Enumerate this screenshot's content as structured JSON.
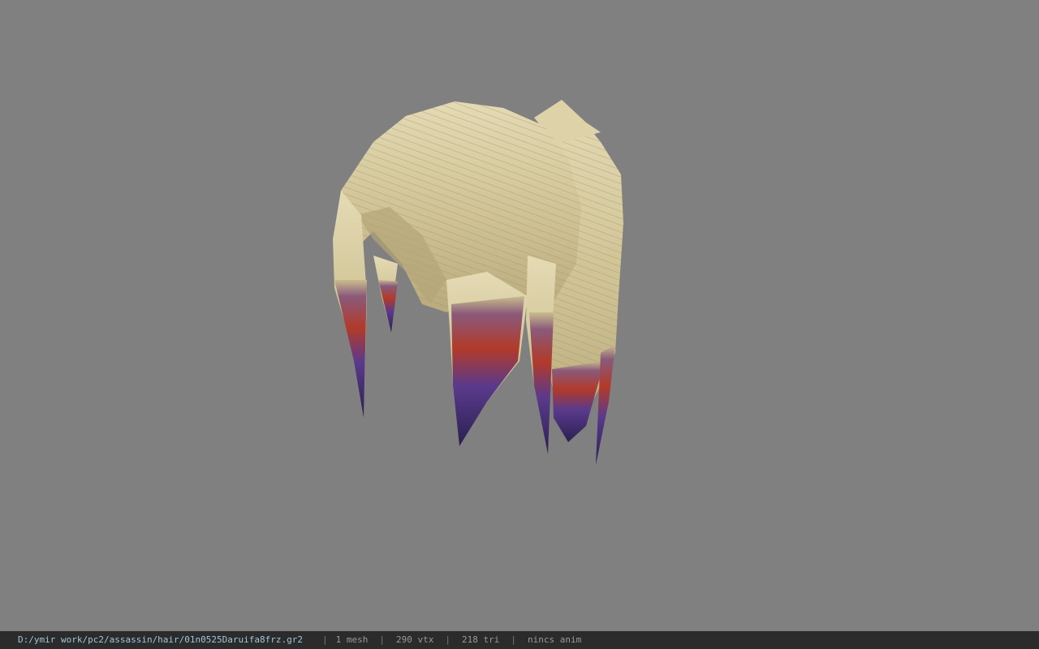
{
  "viewport": {
    "background_color": "#808080",
    "model_icon": "hair-mesh-icon"
  },
  "status": {
    "file_path": "D:/ymir work/pc2/assassin/hair/01n0525Daruifa8frz.gr2",
    "mesh_count": "1 mesh",
    "vertex_count": "290 vtx",
    "triangle_count": "218 tri",
    "anim_state": "nincs anim",
    "separator": "|"
  },
  "colors": {
    "hair_base": "#d6cba0",
    "hair_shadow": "#a89a6e",
    "tip_purple": "#5a3a8c",
    "tip_red": "#b23a2a",
    "statusbar_bg": "#2b2b2b"
  }
}
